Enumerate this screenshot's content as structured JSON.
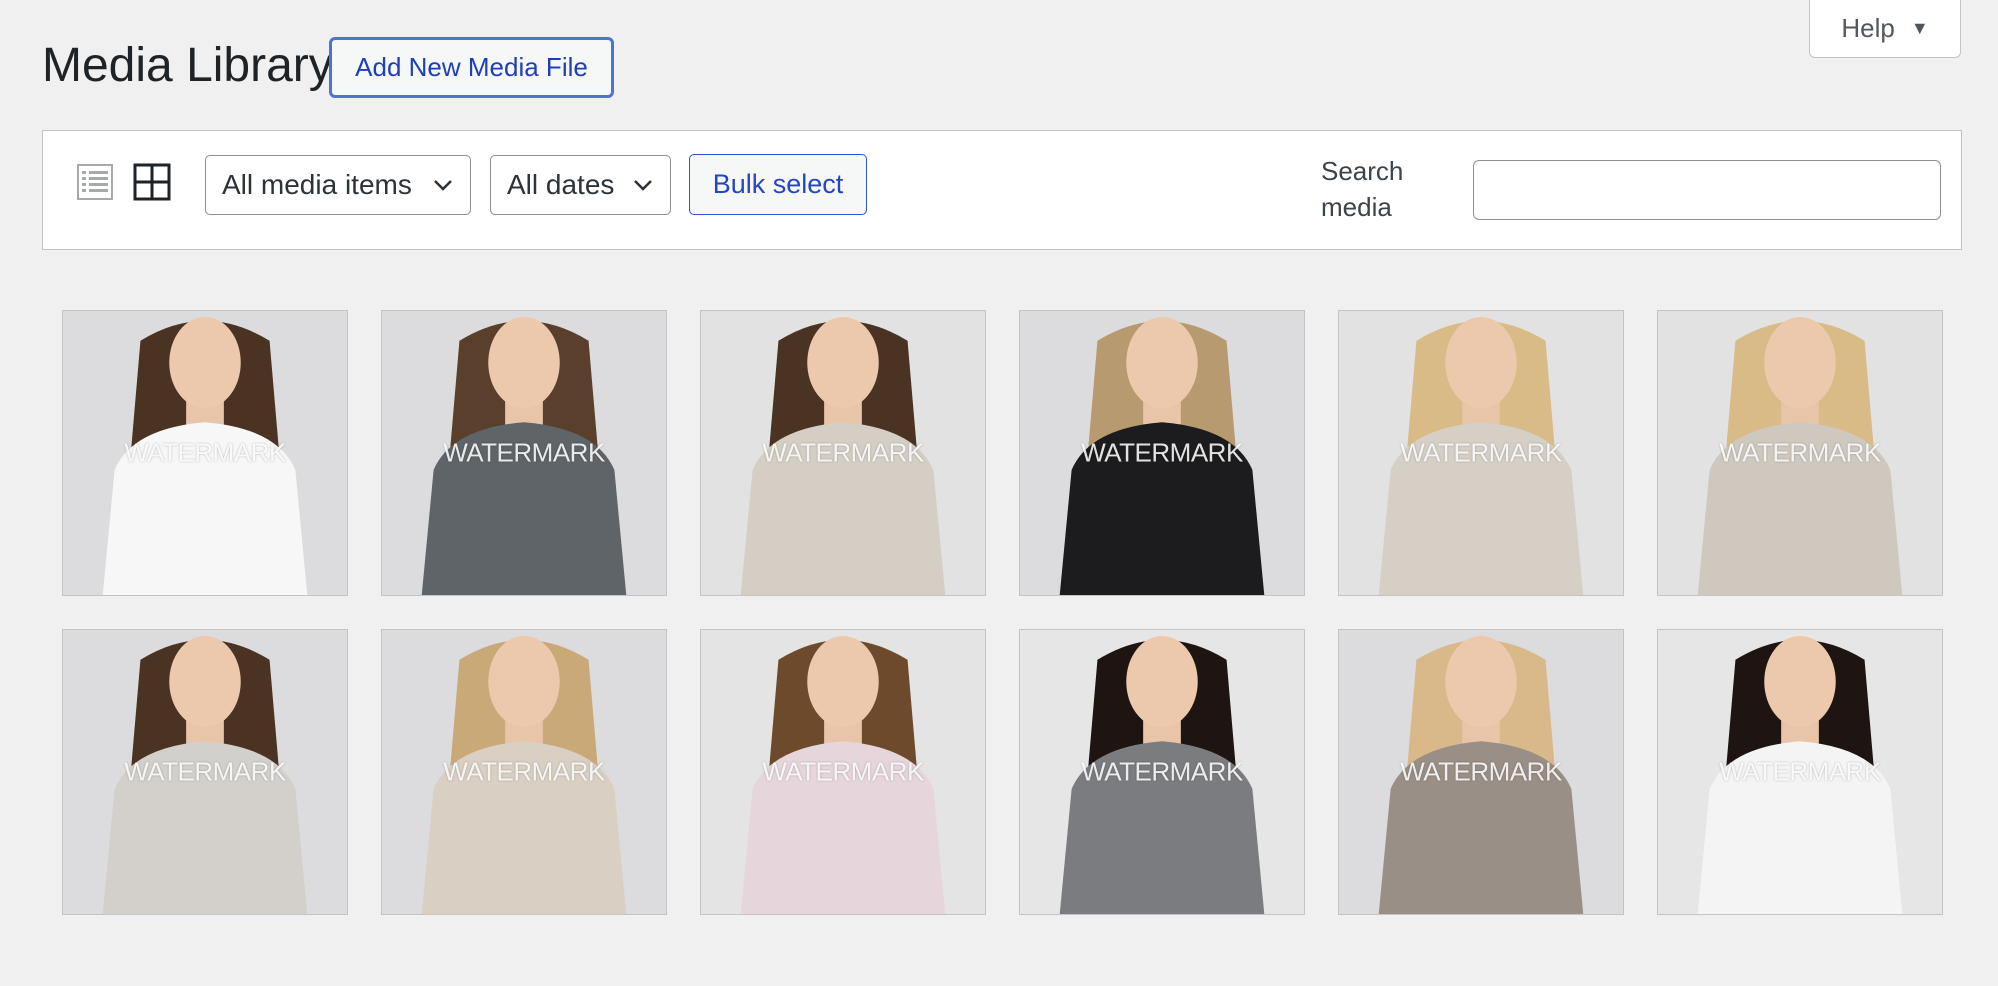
{
  "header": {
    "title": "Media Library",
    "add_new_label": "Add New Media File",
    "help_label": "Help"
  },
  "toolbar": {
    "type_filter": "All media items",
    "date_filter": "All dates",
    "bulk_select_label": "Bulk select",
    "search_label": "Search media",
    "search_value": ""
  },
  "media": [
    {
      "watermark": "WATERMARK",
      "hair": "#4a3322",
      "top": "#f7f7f7",
      "bg": "#dcdcde"
    },
    {
      "watermark": "WATERMARK",
      "hair": "#5a3f2c",
      "top": "#5e6468",
      "bg": "#dcdcde"
    },
    {
      "watermark": "WATERMARK",
      "hair": "#4a3322",
      "top": "#d5cec4",
      "bg": "#e2e2e2"
    },
    {
      "watermark": "WATERMARK",
      "hair": "#b89a70",
      "top": "#1c1c1e",
      "bg": "#dcdcde"
    },
    {
      "watermark": "WATERMARK",
      "hair": "#d8bb86",
      "top": "#d6cfc6",
      "bg": "#e2e2e2"
    },
    {
      "watermark": "WATERMARK",
      "hair": "#d8bb86",
      "top": "#cfc8be",
      "bg": "#e2e2e2"
    },
    {
      "watermark": "WATERMARK",
      "hair": "#4a3322",
      "top": "#d3d0cb",
      "bg": "#dcdcde"
    },
    {
      "watermark": "WATERMARK",
      "hair": "#c9a978",
      "top": "#d9cfc3",
      "bg": "#dcdcde"
    },
    {
      "watermark": "WATERMARK",
      "hair": "#6d4a2c",
      "top": "#e6d6dc",
      "bg": "#e4e4e4"
    },
    {
      "watermark": "WATERMARK",
      "hair": "#1e1512",
      "top": "#7a7c80",
      "bg": "#e6e6e6"
    },
    {
      "watermark": "WATERMARK",
      "hair": "#d9b98a",
      "top": "#9a8f86",
      "bg": "#dcdcde"
    },
    {
      "watermark": "WATERMARK",
      "hair": "#1e1512",
      "top": "#f4f4f4",
      "bg": "#e6e6e6"
    }
  ]
}
